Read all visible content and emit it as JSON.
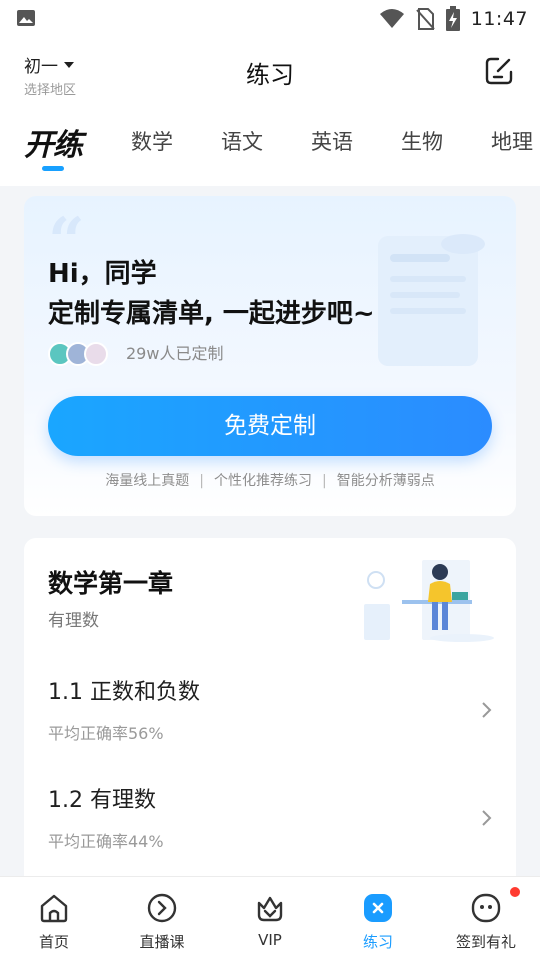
{
  "status_bar": {
    "time": "11:47"
  },
  "app_bar": {
    "grade": "初一",
    "grade_hint": "选择地区",
    "title": "练习"
  },
  "tabs": {
    "brand": "开练",
    "items": [
      "数学",
      "语文",
      "英语",
      "生物",
      "地理"
    ]
  },
  "promo": {
    "line1": "Hi，同学",
    "line2": "定制专属清单, 一起进步吧~",
    "count_text": "29w人已定制",
    "cta": "免费定制",
    "features": [
      "海量线上真题",
      "个性化推荐练习",
      "智能分析薄弱点"
    ]
  },
  "chapter": {
    "title": "数学第一章",
    "subtitle": "有理数",
    "lessons": [
      {
        "name": "1.1 正数和负数",
        "stat": "平均正确率56%"
      },
      {
        "name": "1.2 有理数",
        "stat": "平均正确率44%"
      }
    ]
  },
  "bottom_nav": {
    "items": [
      {
        "label": "首页",
        "icon": "home-icon"
      },
      {
        "label": "直播课",
        "icon": "play-icon"
      },
      {
        "label": "VIP",
        "icon": "vip-icon"
      },
      {
        "label": "练习",
        "icon": "practice-icon",
        "active": true
      },
      {
        "label": "签到有礼",
        "icon": "checkin-icon",
        "badge": true
      }
    ]
  },
  "colors": {
    "accent": "#1a9cff",
    "badge": "#ff3b30"
  }
}
